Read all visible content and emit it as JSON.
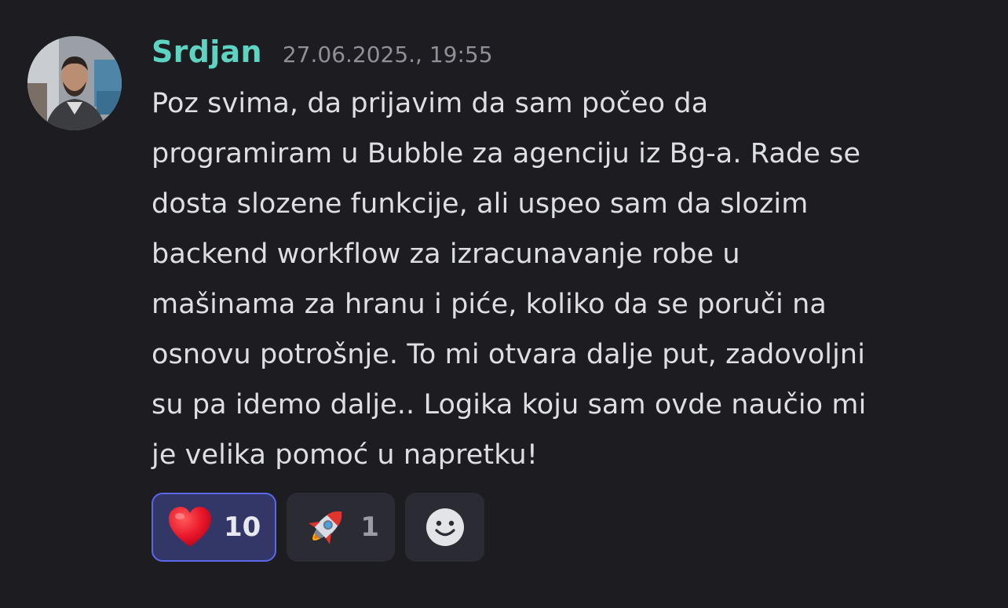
{
  "message": {
    "author": "Srdjan",
    "timestamp": "27.06.2025., 19:55",
    "lines": [
      "Poz svima, da prijavim da sam počeo da",
      "programiram u Bubble za agenciju iz Bg-a. Rade se",
      "dosta slozene funkcije, ali uspeo sam da slozim",
      "backend workflow za izracunavanje robe u",
      "mašinama za hranu i piće, koliko da se poruči na",
      "osnovu potrošnje. To mi otvara dalje put, zadovoljni",
      "su pa idemo dalje.. Logika koju sam ovde naučio mi",
      "je velika pomoć u napretku!"
    ],
    "avatar_icon": "user-avatar"
  },
  "reactions": [
    {
      "icon": "red-heart-icon",
      "count": "10",
      "selected": true
    },
    {
      "icon": "rocket-icon",
      "count": "1",
      "selected": false
    }
  ],
  "add_reaction": {
    "icon": "smiley-face-icon"
  },
  "colors": {
    "background": "#1c1c21",
    "username": "#5fd3c1",
    "timestamp": "#8f9098",
    "text": "#dedfe3",
    "reaction_active_bg": "#333768",
    "reaction_active_border": "#5c66e8",
    "reaction_bg": "#2b2c33"
  }
}
